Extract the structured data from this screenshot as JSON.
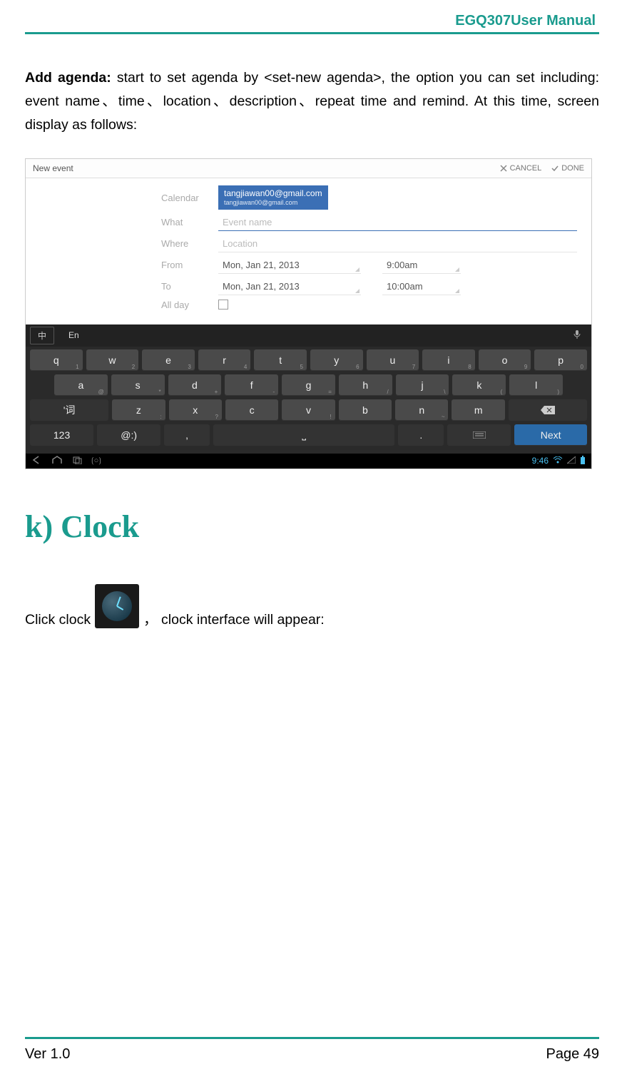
{
  "header": {
    "title": "EGQ307User  Manual"
  },
  "para": {
    "lead": "Add agenda:",
    "rest": " start to set agenda by <set-new agenda>, the option you can set including: event name、time、location、description、repeat time and remind. At this time, screen display as follows:"
  },
  "screenshot": {
    "topbar": {
      "title": "New event",
      "cancel": "CANCEL",
      "done": "DONE"
    },
    "form": {
      "calendar_label": "Calendar",
      "calendar_email": "tangjiawan00@gmail.com",
      "calendar_email_sub": "tangjiawan00@gmail.com",
      "what_label": "What",
      "what_placeholder": "Event name",
      "where_label": "Where",
      "where_placeholder": "Location",
      "from_label": "From",
      "from_date": "Mon, Jan 21, 2013",
      "from_time": "9:00am",
      "to_label": "To",
      "to_date": "Mon, Jan 21, 2013",
      "to_time": "10:00am",
      "allday_label": "All day"
    },
    "kb": {
      "ch": "中",
      "en": "En",
      "row1": [
        {
          "k": "q",
          "s": "1"
        },
        {
          "k": "w",
          "s": "2"
        },
        {
          "k": "e",
          "s": "3"
        },
        {
          "k": "r",
          "s": "4"
        },
        {
          "k": "t",
          "s": "5"
        },
        {
          "k": "y",
          "s": "6"
        },
        {
          "k": "u",
          "s": "7"
        },
        {
          "k": "i",
          "s": "8"
        },
        {
          "k": "o",
          "s": "9"
        },
        {
          "k": "p",
          "s": "0"
        }
      ],
      "row2": [
        {
          "k": "a",
          "s": "@"
        },
        {
          "k": "s",
          "s": "*"
        },
        {
          "k": "d",
          "s": "+"
        },
        {
          "k": "f",
          "s": "-"
        },
        {
          "k": "g",
          "s": "="
        },
        {
          "k": "h",
          "s": "/"
        },
        {
          "k": "j",
          "s": "\\"
        },
        {
          "k": "k",
          "s": "("
        },
        {
          "k": "l",
          "s": ")"
        }
      ],
      "row3_left": "'词",
      "row3": [
        {
          "k": "z",
          "s": ":"
        },
        {
          "k": "x",
          "s": "?"
        },
        {
          "k": "c",
          "s": ""
        },
        {
          "k": "v",
          "s": "!"
        },
        {
          "k": "b",
          "s": ""
        },
        {
          "k": "n",
          "s": "~"
        },
        {
          "k": "m",
          "s": ""
        }
      ],
      "row4": {
        "sym": "123",
        "emoji": "@:)",
        "comma": ",",
        "period": ".",
        "next": "Next"
      }
    },
    "statusbar": {
      "time": "9:46"
    }
  },
  "section": {
    "heading": "k) Clock"
  },
  "clock_para": {
    "before": "Click clock ",
    "after": "， clock interface will appear:"
  },
  "footer": {
    "ver": "Ver 1.0",
    "page": "Page 49"
  }
}
